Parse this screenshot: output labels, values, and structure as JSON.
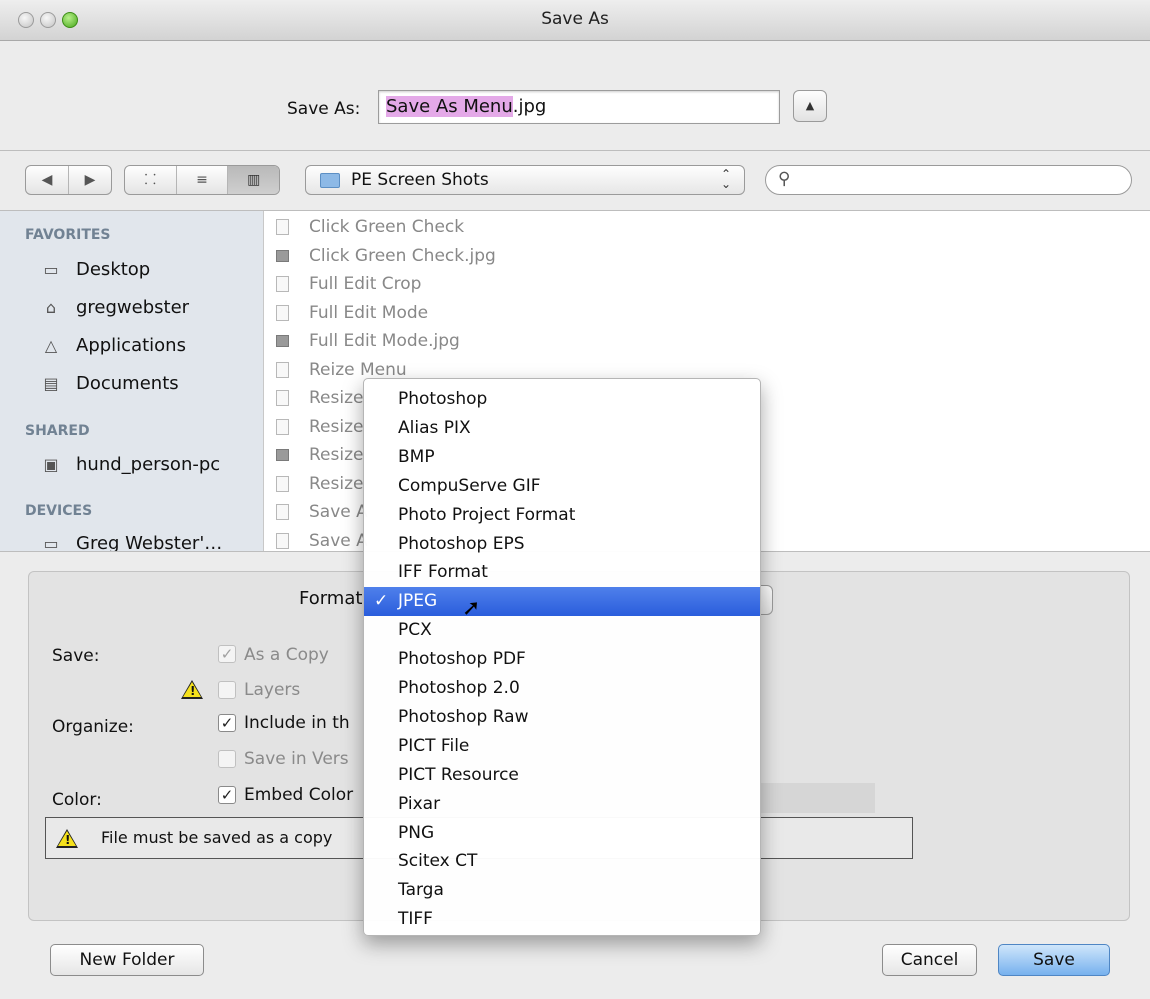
{
  "window": {
    "title": "Save As"
  },
  "save_as": {
    "label": "Save As:",
    "filename_selected": "Save As Menu",
    "filename_ext": ".jpg",
    "expand_glyph": "▲"
  },
  "toolbar": {
    "back_glyph": "◀",
    "forward_glyph": "▶",
    "view_icons": "⸬",
    "view_list": "≡",
    "view_columns": "▥",
    "location": "PE Screen Shots",
    "location_arrows": "⌃⌄",
    "search_glyph": "⚲",
    "search_placeholder": ""
  },
  "sidebar": {
    "favorites_header": "FAVORITES",
    "favorites": [
      {
        "label": "Desktop",
        "icon": "desktop-icon"
      },
      {
        "label": "gregwebster",
        "icon": "home-icon"
      },
      {
        "label": "Applications",
        "icon": "applications-icon"
      },
      {
        "label": "Documents",
        "icon": "documents-icon"
      }
    ],
    "shared_header": "SHARED",
    "shared": [
      {
        "label": "hund_person-pc",
        "icon": "computer-icon"
      }
    ],
    "devices_header": "DEVICES",
    "devices": [
      {
        "label": "Greg Webster'…",
        "icon": "laptop-icon"
      }
    ]
  },
  "files": [
    {
      "name": "Click Green Check",
      "type": "doc"
    },
    {
      "name": "Click Green Check.jpg",
      "type": "img"
    },
    {
      "name": "Full Edit Crop",
      "type": "doc"
    },
    {
      "name": "Full Edit Mode",
      "type": "doc"
    },
    {
      "name": "Full Edit Mode.jpg",
      "type": "img"
    },
    {
      "name": "Reize Menu",
      "type": "doc"
    },
    {
      "name": "Resize",
      "type": "doc"
    },
    {
      "name": "Resize",
      "type": "doc"
    },
    {
      "name": "Resize",
      "type": "img"
    },
    {
      "name": "Resize",
      "type": "doc"
    },
    {
      "name": "Save A",
      "type": "doc"
    },
    {
      "name": "Save A",
      "type": "doc"
    }
  ],
  "options": {
    "format_label": "Format",
    "save_label": "Save:",
    "as_a_copy": "As a Copy",
    "layers": "Layers",
    "organize_label": "Organize:",
    "include_in": "Include in th",
    "save_in_version": "Save in Vers",
    "color_label": "Color:",
    "embed_color": "Embed Color",
    "warning_text": "File must be saved as a copy",
    "check_glyph": "✓",
    "warn_glyph": "!"
  },
  "format_menu": {
    "items": [
      "Photoshop",
      "Alias PIX",
      "BMP",
      "CompuServe GIF",
      "Photo Project Format",
      "Photoshop EPS",
      "IFF Format",
      "JPEG",
      "PCX",
      "Photoshop PDF",
      "Photoshop 2.0",
      "Photoshop Raw",
      "PICT File",
      "PICT Resource",
      "Pixar",
      "PNG",
      "Scitex CT",
      "Targa",
      "TIFF"
    ],
    "selected": "JPEG",
    "check_glyph": "✓"
  },
  "footer": {
    "new_folder": "New Folder",
    "cancel": "Cancel",
    "save": "Save"
  },
  "colors": {
    "selection_highlight": "#e4a9e8",
    "menu_selection": "#2a5ddc",
    "sidebar_bg": "#e1e6ec",
    "warning_yellow": "#f5e11c"
  }
}
